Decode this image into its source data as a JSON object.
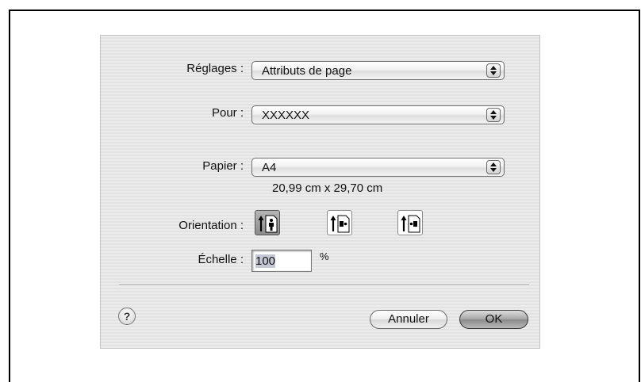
{
  "dialog": {
    "settings": {
      "label": "Réglages :",
      "value": "Attributs de page"
    },
    "format_for": {
      "label": "Pour :",
      "value": "XXXXXX"
    },
    "paper": {
      "label": "Papier :",
      "value": "A4",
      "size_text": "20,99 cm x 29,70 cm"
    },
    "orientation": {
      "label": "Orientation :",
      "options": [
        {
          "name": "portrait",
          "selected": true
        },
        {
          "name": "landscape-left",
          "selected": false
        },
        {
          "name": "landscape-right",
          "selected": false
        }
      ]
    },
    "scale": {
      "label": "Échelle :",
      "value": "100",
      "unit": "%"
    },
    "help": {
      "glyph": "?"
    },
    "buttons": {
      "cancel": "Annuler",
      "ok": "OK"
    }
  }
}
